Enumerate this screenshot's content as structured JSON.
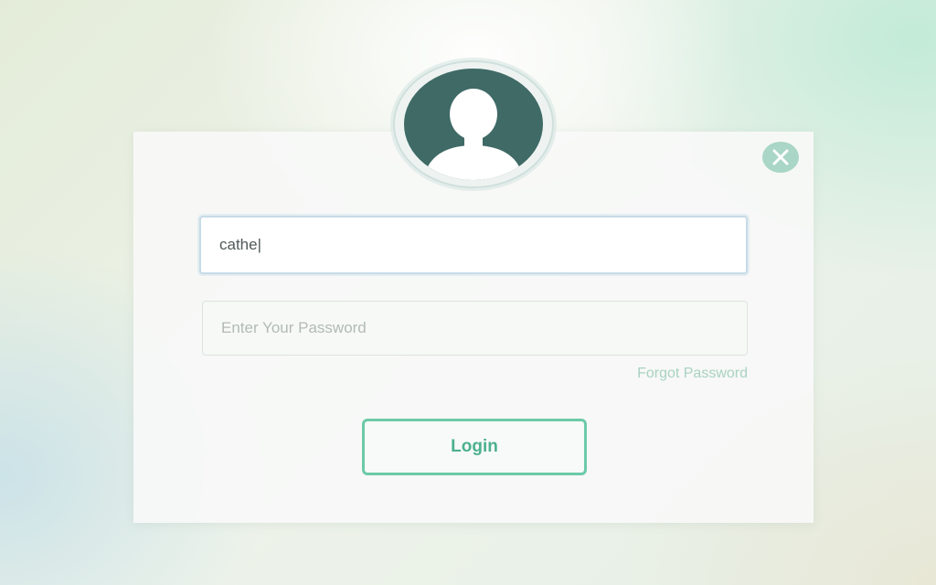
{
  "login_form": {
    "username": {
      "value": "cathe|",
      "icon": "user-avatar-icon"
    },
    "password": {
      "value": "",
      "placeholder": "Enter Your Password"
    },
    "forgot_password_label": "Forgot Password",
    "login_button_label": "Login",
    "close_icon": "close-icon"
  },
  "colors": {
    "accent": "#6ccaa9",
    "avatar_bg": "#3f6a66",
    "close_bg": "#a9d6c6",
    "link": "#a9d2c2"
  }
}
